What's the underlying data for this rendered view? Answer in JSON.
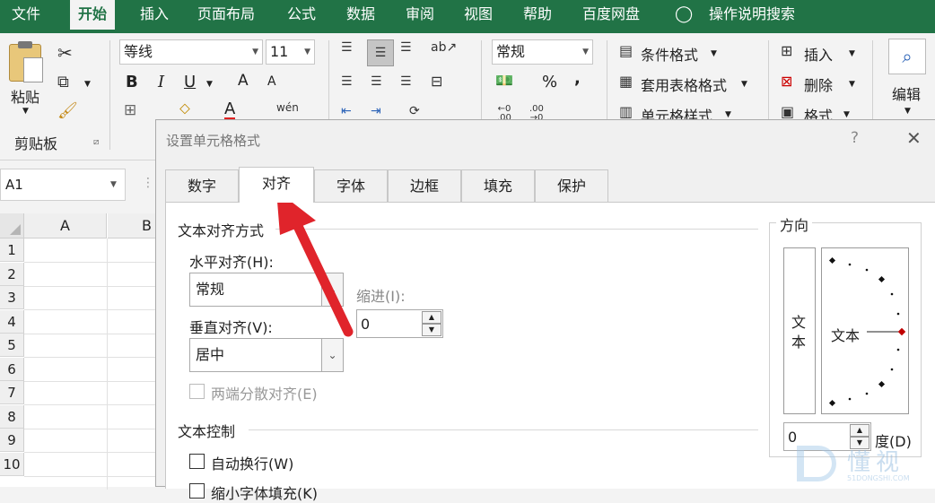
{
  "ribbon_tabs": [
    "文件",
    "开始",
    "插入",
    "页面布局",
    "公式",
    "数据",
    "审阅",
    "视图",
    "帮助",
    "百度网盘",
    "操作说明搜索"
  ],
  "clipboard": {
    "paste_label": "粘贴",
    "group_label": "剪贴板"
  },
  "font": {
    "name": "等线",
    "size": "11",
    "bold": "B",
    "italic": "I",
    "underline": "U",
    "grow": "A",
    "shrink": "A",
    "color": "A"
  },
  "number": {
    "format": "常规",
    "percent": "%",
    "comma": ","
  },
  "styles": {
    "conditional": "条件格式",
    "table": "套用表格格式",
    "cell": "单元格样式"
  },
  "cells": {
    "insert": "插入",
    "delete": "删除",
    "format": "格式"
  },
  "editing": {
    "label": "编辑"
  },
  "namebox": "A1",
  "columns": [
    "A",
    "B"
  ],
  "rows": [
    "1",
    "2",
    "3",
    "4",
    "5",
    "6",
    "7",
    "8",
    "9",
    "10"
  ],
  "dialog": {
    "title": "设置单元格格式",
    "help": "?",
    "close": "✕",
    "tabs": [
      "数字",
      "对齐",
      "字体",
      "边框",
      "填充",
      "保护"
    ],
    "text_align_section": "文本对齐方式",
    "horizontal_label": "水平对齐(H):",
    "horizontal_value": "常规",
    "indent_label": "缩进(I):",
    "indent_value": "0",
    "vertical_label": "垂直对齐(V):",
    "vertical_value": "居中",
    "justify_distributed": "两端分散对齐(E)",
    "text_control_section": "文本控制",
    "wrap_text": "自动换行(W)",
    "shrink_text": "缩小字体填充(K)",
    "orientation_section": "方向",
    "vertical_text": "文本",
    "orientation_text": "文本",
    "degrees_value": "0",
    "degrees_label": "度(D)"
  },
  "watermark": {
    "brand": "懂视",
    "url": "51DONGSHI.COM"
  },
  "colors": {
    "excel_green": "#217346",
    "arrow_red": "#e0242b",
    "marker_red": "#c00000"
  }
}
